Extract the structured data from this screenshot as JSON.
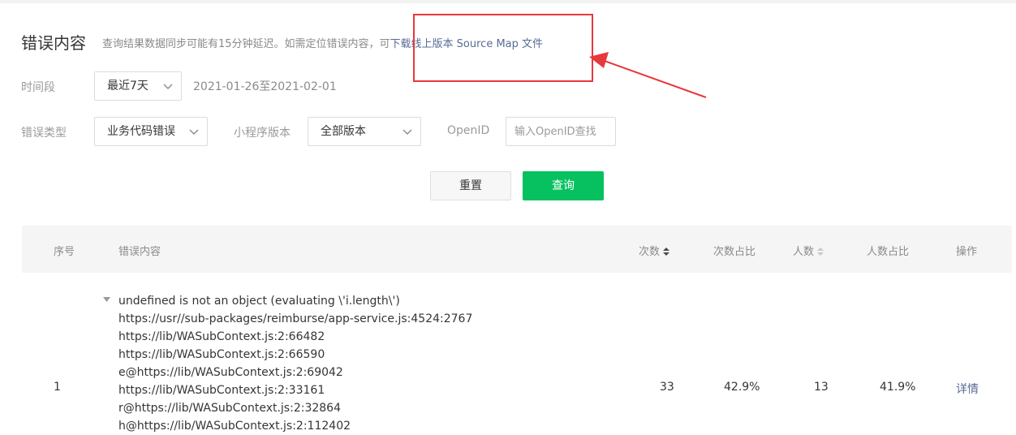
{
  "header": {
    "title": "错误内容",
    "hint": "查询结果数据同步可能有15分钟延迟。如需定位错误内容，可",
    "download_link": "下载线上版本 Source Map 文件"
  },
  "filters": {
    "period_label": "时间段",
    "period_value": "最近7天",
    "date_range": "2021-01-26至2021-02-01",
    "error_type_label": "错误类型",
    "error_type_value": "业务代码错误",
    "version_label": "小程序版本",
    "version_value": "全部版本",
    "openid_label": "OpenID",
    "openid_placeholder": "输入OpenID查找"
  },
  "actions": {
    "reset_label": "重置",
    "query_label": "查询"
  },
  "table": {
    "columns": {
      "index": "序号",
      "content": "错误内容",
      "count": "次数",
      "count_ratio": "次数占比",
      "users": "人数",
      "users_ratio": "人数占比",
      "operation": "操作"
    },
    "rows": [
      {
        "index": "1",
        "lines": [
          "undefined is not an object (evaluating \\'i.length\\')",
          "https://usr//sub-packages/reimburse/app-service.js:4524:2767",
          "https://lib/WASubContext.js:2:66482",
          "https://lib/WASubContext.js:2:66590",
          "e@https://lib/WASubContext.js:2:69042",
          "https://lib/WASubContext.js:2:33161",
          "r@https://lib/WASubContext.js:2:32864",
          "h@https://lib/WASubContext.js:2:112402"
        ],
        "count": "33",
        "count_ratio": "42.9%",
        "users": "13",
        "users_ratio": "41.9%",
        "operation": "详情"
      }
    ]
  },
  "colors": {
    "primary_green": "#07c160",
    "link_blue": "#576b95",
    "annotation_red": "#e8383d"
  }
}
